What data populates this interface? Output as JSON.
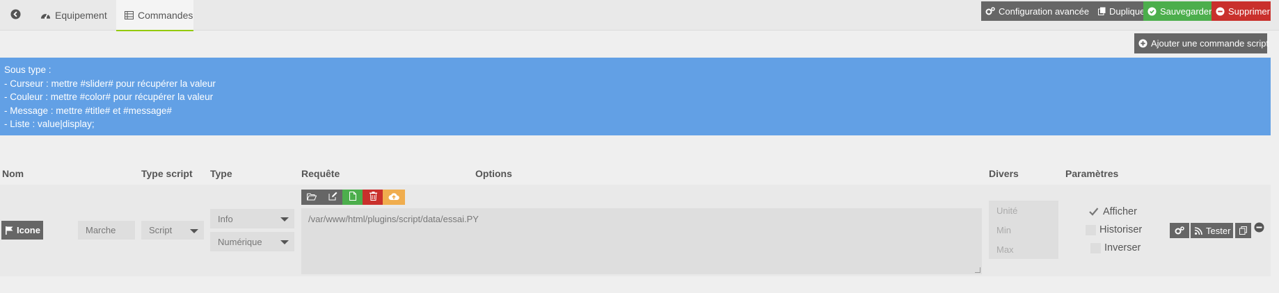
{
  "tabs": {
    "back_icon": "circle-arrow-left-icon",
    "equipement": "Equipement",
    "commandes": "Commandes"
  },
  "actions": {
    "config": "Configuration avancée",
    "duplicate": "Dupliquer",
    "save": "Sauvegarder",
    "delete": "Supprimer",
    "add_command": "Ajouter une commande script"
  },
  "info_lines": [
    "Sous type :",
    "- Curseur : mettre #slider# pour récupérer la valeur",
    "- Couleur : mettre #color# pour récupérer la valeur",
    "- Message : mettre #title# et #message#",
    "- Liste : value|display;"
  ],
  "table": {
    "headers": {
      "nom": "Nom",
      "type_script": "Type script",
      "type": "Type",
      "requete": "Requête",
      "options": "Options",
      "divers": "Divers",
      "parametres": "Paramètres"
    },
    "row": {
      "icon_button": "Icone",
      "name_value": "Marche",
      "type_script_value": "Script",
      "type_value": "Info",
      "subtype_value": "Numérique",
      "request_value": "/var/www/html/plugins/script/data/essai.PY",
      "unit_placeholder": "Unité",
      "min_placeholder": "Min",
      "max_placeholder": "Max",
      "param_show": "Afficher",
      "param_history": "Historiser",
      "param_invert": "Inverser",
      "show_checked": true,
      "history_checked": false,
      "invert_checked": false,
      "test_button": "Tester"
    }
  },
  "colors": {
    "info_bg": "#62a0e5",
    "green": "#4cae4c",
    "red": "#c9302c",
    "orange": "#f0ad4e",
    "dark": "#666666"
  }
}
